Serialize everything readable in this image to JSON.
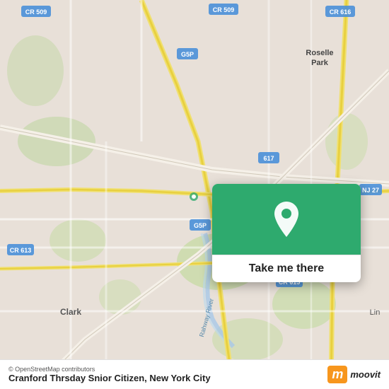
{
  "map": {
    "attribution": "© OpenStreetMap contributors",
    "background_color": "#e8e0d8"
  },
  "popup": {
    "button_label": "Take me there",
    "pin_icon": "location-pin"
  },
  "bottom_bar": {
    "location_name": "Cranford Thrsday Snior Citizen, New York City",
    "attribution": "© OpenStreetMap contributors"
  },
  "moovit": {
    "letter": "m",
    "name": "moovit"
  }
}
